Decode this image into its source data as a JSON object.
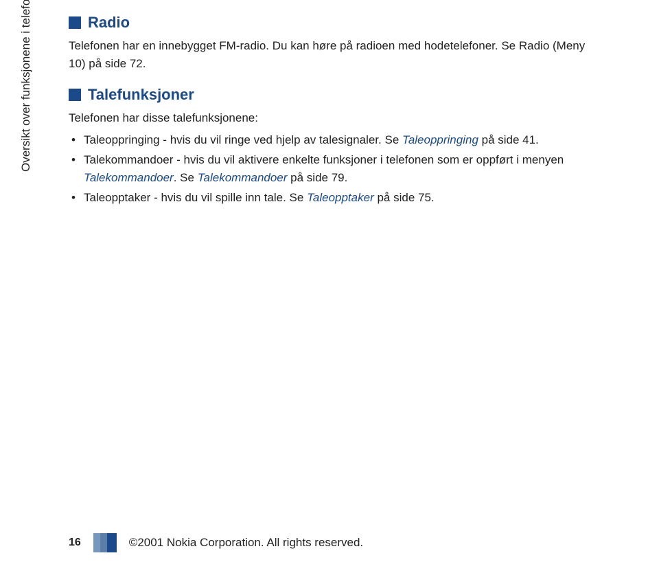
{
  "sidebar_label": "Oversikt over funksjonene i telefonen",
  "sections": [
    {
      "heading": "Radio",
      "body": "Telefonen har en innebygget FM-radio. Du kan høre på radioen med hodetelefoner. Se Radio (Meny 10) på side 72."
    },
    {
      "heading": "Talefunksjoner",
      "intro": "Telefonen har disse talefunksjonene:",
      "bullets": [
        {
          "pre": "Taleoppringing - hvis du vil ringe ved hjelp av talesignaler. Se ",
          "link": "Taleoppringing",
          "post": " på side 41."
        },
        {
          "pre": "Talekommandoer - hvis du vil aktivere enkelte funksjoner i telefonen som er oppført i menyen ",
          "link": "Talekommandoer",
          "post_pre": ". Se ",
          "link2": "Talekommandoer",
          "post": " på side 79."
        },
        {
          "pre": "Taleopptaker - hvis du vil spille inn tale. Se ",
          "link": "Taleopptaker",
          "post": " på side 75."
        }
      ]
    }
  ],
  "footer": {
    "page_number": "16",
    "copyright": "©2001 Nokia Corporation. All rights reserved."
  }
}
